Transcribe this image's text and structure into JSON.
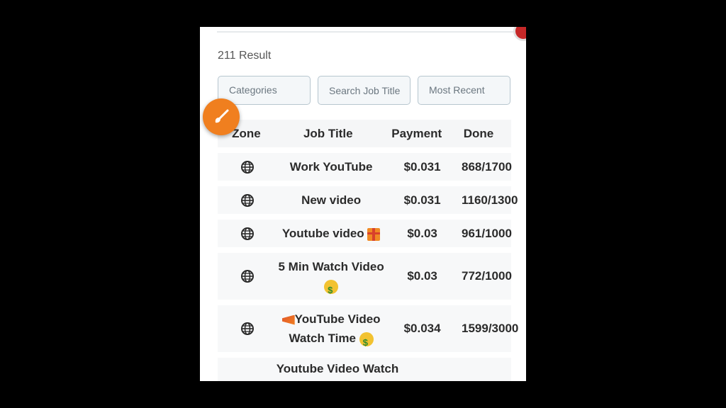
{
  "results": {
    "count_label": "211 Result"
  },
  "filters": {
    "categories_label": "Categories",
    "search_placeholder": "Search Job Title",
    "sort_label": "Most Recent"
  },
  "table": {
    "headers": {
      "zone": "Zone",
      "title": "Job Title",
      "payment": "Payment",
      "done": "Done"
    },
    "rows": [
      {
        "title": "Work YouTube",
        "payment": "$0.031",
        "done": "868/1700"
      },
      {
        "title": "New video",
        "payment": "$0.031",
        "done": "1160/1300"
      },
      {
        "title": "Youtube video",
        "title_emoji": "gift",
        "payment": "$0.03",
        "done": "961/1000"
      },
      {
        "title_line1": "5 Min Watch Video",
        "title_emoji": "money-mouth-face",
        "payment": "$0.03",
        "done": "772/1000"
      },
      {
        "title_line1": "YouTube Video",
        "title_line2": "Watch Time",
        "title_prefix_emoji": "megaphone",
        "title_emoji": "money-mouth-face",
        "payment": "$0.034",
        "done": "1599/3000"
      },
      {
        "title_line1": "Youtube Video Watch"
      }
    ]
  },
  "icons": {
    "zone_icon": "globe-icon",
    "fab_icon": "paintbrush-icon"
  },
  "colors": {
    "fab": "#f07f1f",
    "row_bg": "#f7f8f9",
    "filter_border": "#b7c6cf"
  }
}
